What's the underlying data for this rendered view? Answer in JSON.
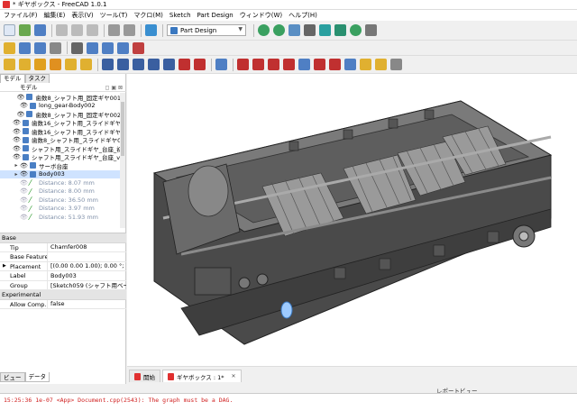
{
  "window": {
    "title": "* ギヤボックス - FreeCAD 1.0.1"
  },
  "menu": [
    "ファイル(F)",
    "編集(E)",
    "表示(V)",
    "ツール(T)",
    "マクロ(M)",
    "Sketch",
    "Part Design",
    "ウィンドウ(W)",
    "ヘルプ(H)"
  ],
  "workbench": {
    "selected": "Part Design"
  },
  "combo_view": {
    "tabs": [
      "モデル",
      "タスク"
    ],
    "tree_header": "モデル",
    "tree": [
      {
        "label": "歯数8_シャフト用_固定ギヤ001",
        "icon": "body-icon"
      },
      {
        "label": "long_gear-Body002",
        "icon": "body-icon"
      },
      {
        "label": "歯数8_シャフト用_固定ギヤ002",
        "icon": "body-icon"
      },
      {
        "label": "歯数16_シャフト用_スライドギヤ-Bod...",
        "icon": "body-icon"
      },
      {
        "label": "歯数16_シャフト用_スライドギヤ_台...",
        "icon": "body-icon"
      },
      {
        "label": "歯数8_シャフト用_スライドギヤ003",
        "icon": "body-icon"
      },
      {
        "label": "シャフト用_スライドギヤ_台座_初代...",
        "icon": "body-icon"
      },
      {
        "label": "シャフト用_スライドギヤ_台座_ver3-B...",
        "icon": "body-icon"
      },
      {
        "label": "サーボ台座",
        "icon": "body-icon",
        "expander": "▸"
      },
      {
        "label": "Body003",
        "icon": "body-icon",
        "expander": "▸",
        "selected": true
      },
      {
        "label": "Distance: 8.07 mm",
        "icon": "dist-icon",
        "dim": true
      },
      {
        "label": "Distance: 8.00 mm",
        "icon": "dist-icon",
        "dim": true
      },
      {
        "label": "Distance: 36.50 mm",
        "icon": "dist-icon",
        "dim": true
      },
      {
        "label": "Distance: 3.97 mm",
        "icon": "dist-icon",
        "dim": true
      },
      {
        "label": "Distance: 51.93 mm",
        "icon": "dist-icon",
        "dim": true
      }
    ]
  },
  "properties": {
    "groups": [
      {
        "name": "Base",
        "rows": [
          {
            "key": "Tip",
            "value": "Chamfer008"
          },
          {
            "key": "Base Feature",
            "value": ""
          },
          {
            "key": "Placement",
            "value": "[(0.00 0.00 1.00); 0.00 °; (0.00 ...",
            "arrow": true
          },
          {
            "key": "Label",
            "value": "Body003"
          },
          {
            "key": "Group",
            "value": "[Sketch059 (シャフト用ベース..."
          }
        ]
      },
      {
        "name": "Experimental",
        "rows": [
          {
            "key": "Allow Comp...",
            "value": "false"
          }
        ]
      }
    ]
  },
  "combo_bottom_tabs": [
    "ビュー",
    "データ"
  ],
  "doc_tabs": [
    {
      "label": "開始",
      "active": false
    },
    {
      "label": "ギヤボックス : 1*",
      "active": true
    }
  ],
  "report_view": {
    "title": "レポートビュー",
    "message": "15:25:36  1e-07 <App> Document.cpp(2543): The graph must be a DAG."
  },
  "colors": {
    "model": "#5a5a5a",
    "selection": "#cfe3ff",
    "error_text": "#d02020",
    "accent": "#3a78c0"
  }
}
